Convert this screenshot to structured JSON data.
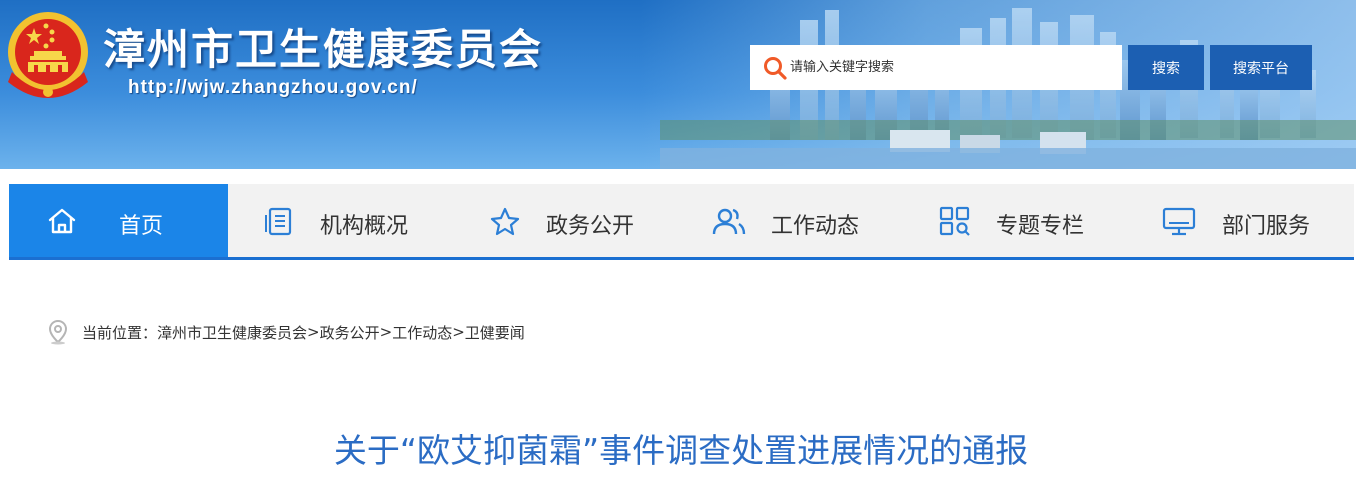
{
  "header": {
    "site_title": "漳州市卫生健康委员会",
    "site_url": "http://wjw.zhangzhou.gov.cn/",
    "emblem_icon": "national-emblem-icon"
  },
  "search": {
    "placeholder": "请输入关键字搜索",
    "search_button": "搜索",
    "platform_button": "搜索平台",
    "icon": "search-icon",
    "icon_color": "#f05a28"
  },
  "nav": {
    "items": [
      {
        "label": "首页",
        "icon": "home-icon",
        "active": true
      },
      {
        "label": "机构概况",
        "icon": "document-icon",
        "active": false
      },
      {
        "label": "政务公开",
        "icon": "star-icon",
        "active": false
      },
      {
        "label": "工作动态",
        "icon": "users-icon",
        "active": false
      },
      {
        "label": "专题专栏",
        "icon": "grid-search-icon",
        "active": false
      },
      {
        "label": "部门服务",
        "icon": "monitor-icon",
        "active": false
      }
    ]
  },
  "breadcrumb": {
    "prefix": "当前位置：",
    "items": [
      "漳州市卫生健康委员会",
      "政务公开",
      "工作动态",
      "卫健要闻"
    ],
    "separator": ">"
  },
  "article": {
    "title": "关于“欧艾抑菌霜”事件调查处置进展情况的通报"
  },
  "colors": {
    "nav_active": "#1b85e8",
    "nav_border": "#1b6fd1",
    "button_bg": "#1c5fb2",
    "title_color": "#2b6cc4",
    "icon_blue": "#2c7fd6"
  }
}
